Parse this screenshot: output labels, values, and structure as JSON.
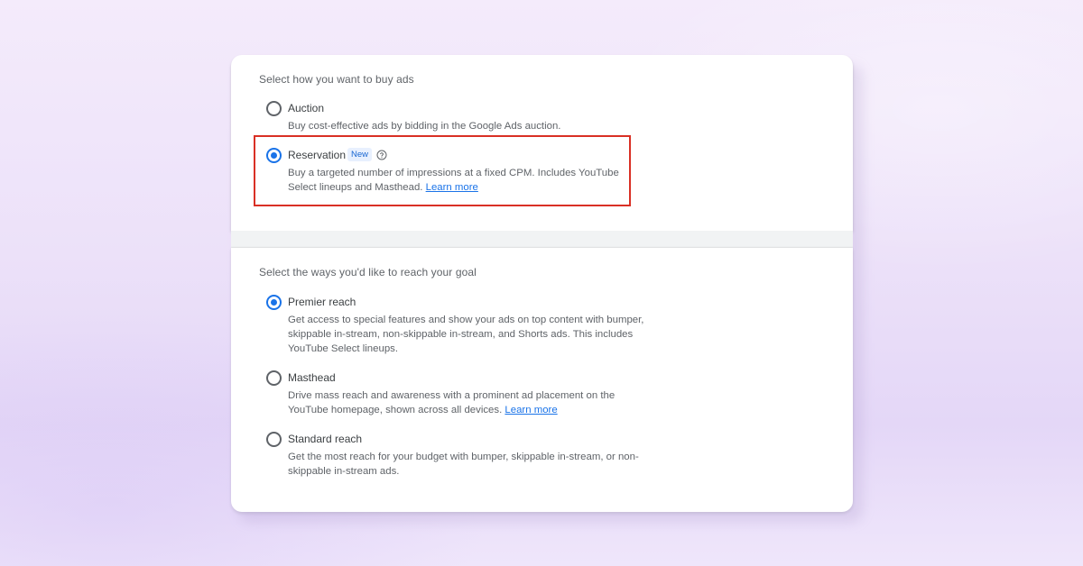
{
  "buy_section": {
    "title": "Select how you want to buy ads",
    "options": [
      {
        "label": "Auction",
        "description": "Buy cost-effective ads by bidding in the Google Ads auction.",
        "selected": false
      },
      {
        "label": "Reservation",
        "badge": "New",
        "help_icon": "help-circle-icon",
        "description_line1": "Buy a targeted number of impressions at a fixed CPM. Includes YouTube",
        "description_line2": "Select lineups and Masthead.",
        "link": "Learn more",
        "selected": true
      }
    ]
  },
  "reach_section": {
    "title": "Select the ways you'd like to reach your goal",
    "options": [
      {
        "label": "Premier reach",
        "description_lines": [
          "Get access to special features and show your ads on top content with bumper,",
          "skippable in-stream, non-skippable in-stream, and Shorts ads. This includes",
          "YouTube Select lineups."
        ],
        "selected": true
      },
      {
        "label": "Masthead",
        "description_line1": "Drive mass reach and awareness with a prominent ad placement on the",
        "description_line2": "YouTube homepage, shown across all devices.",
        "link": "Learn more",
        "selected": false
      },
      {
        "label": "Standard reach",
        "description_lines": [
          "Get the most reach for your budget with bumper, skippable in-stream, or non-",
          "skippable in-stream ads."
        ],
        "selected": false
      }
    ]
  },
  "colors": {
    "accent": "#1a73e8",
    "highlight": "#d93025"
  }
}
